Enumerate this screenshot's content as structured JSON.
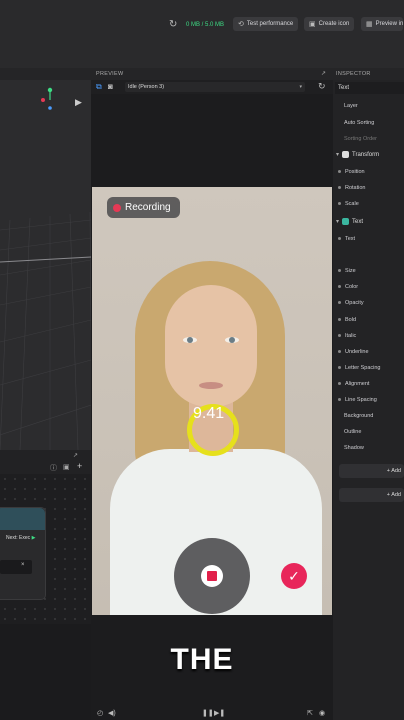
{
  "topbar": {
    "memory_used": "0 MB",
    "memory_total": "5.0 MB",
    "test_performance": "Test performance",
    "create_icon": "Create icon",
    "preview_in": "Preview in"
  },
  "preview": {
    "panel_title": "PREVIEW",
    "selected_preset": "Idle (Person 3)",
    "recording_label": "Recording",
    "timer": "9.41",
    "caption": "THE"
  },
  "inspector": {
    "panel_title": "INSPECTOR",
    "object_name": "Text",
    "rows": {
      "layer": "Layer",
      "auto_sorting": "Auto Sorting",
      "sorting_order": "Sorting Order",
      "transform": "Transform",
      "position": "Position",
      "rotation": "Rotation",
      "scale": "Scale",
      "text_section": "Text",
      "text": "Text",
      "size": "Size",
      "color": "Color",
      "opacity": "Opacity",
      "bold": "Bold",
      "italic": "Italic",
      "underline": "Underline",
      "letter_spacing": "Letter Spacing",
      "alignment": "Alignment",
      "line_spacing": "Line Spacing",
      "background": "Background",
      "outline": "Outline",
      "shadow": "Shadow"
    },
    "add_button_1": "+ Add",
    "add_button_2": "+ Add"
  },
  "node_editor": {
    "next_label": "Next: Exec",
    "close_symbol": "×"
  },
  "colors": {
    "accent_blue": "#4a9cff",
    "memory_green": "#3ddc84",
    "record_red": "#e53955",
    "timer_ring": "#e6e01c",
    "confirm_pink": "#e8265a"
  }
}
